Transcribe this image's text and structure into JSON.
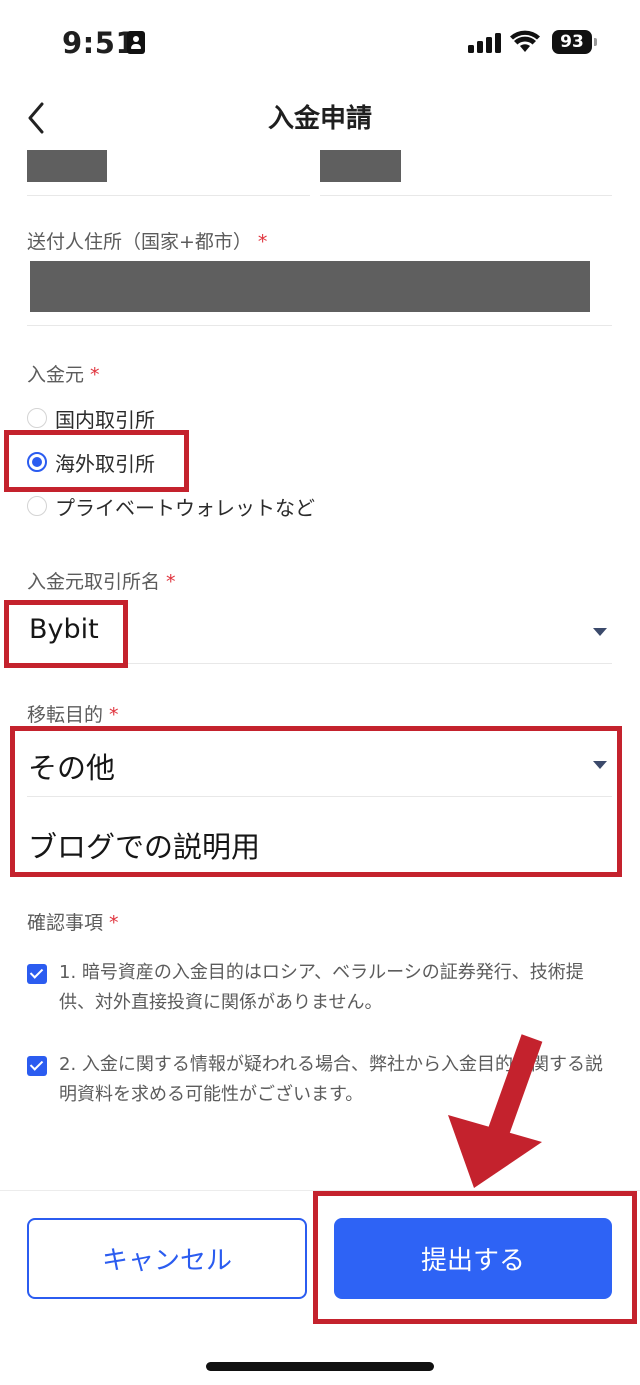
{
  "status_bar": {
    "time": "9:51",
    "battery": "93"
  },
  "nav": {
    "title": "入金申請"
  },
  "address": {
    "label": "送付人住所（国家+都市）",
    "required_mark": "*"
  },
  "source": {
    "label": "入金元",
    "required_mark": "*",
    "options": [
      {
        "label": "国内取引所",
        "selected": false
      },
      {
        "label": "海外取引所",
        "selected": true
      },
      {
        "label": "プライベートウォレットなど",
        "selected": false
      }
    ]
  },
  "exchange_name": {
    "label": "入金元取引所名",
    "required_mark": "*",
    "value": "Bybit"
  },
  "purpose": {
    "label": "移転目的",
    "required_mark": "*",
    "value": "その他",
    "detail": "ブログでの説明用"
  },
  "confirm": {
    "label": "確認事項",
    "required_mark": "*",
    "items": [
      {
        "text": "1. 暗号資産の入金目的はロシア、ベラルーシの証券発行、技術提供、対外直接投資に関係がありません。",
        "checked": true
      },
      {
        "text": "2. 入金に関する情報が疑われる場合、弊社から入金目的に関する説明資料を求める可能性がございます。",
        "checked": true
      }
    ]
  },
  "buttons": {
    "cancel": "キャンセル",
    "submit": "提出する"
  },
  "colors": {
    "accent": "#2E63F5",
    "annotation_red": "#C4222D",
    "required": "#E0333D"
  }
}
